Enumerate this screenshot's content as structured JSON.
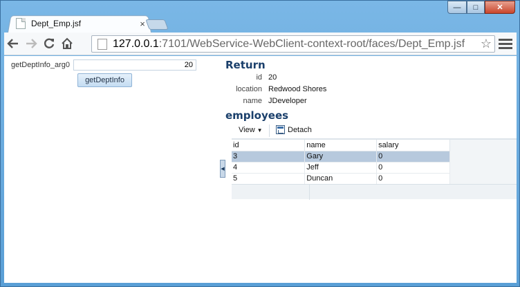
{
  "browser": {
    "tab_title": "Dept_Emp.jsf",
    "tab_close": "×",
    "window_minimize": "—",
    "window_maximize": "□",
    "window_close": "✕",
    "back_icon": "arrow-left-icon",
    "forward_icon": "arrow-right-icon",
    "reload_icon": "reload-icon",
    "home_icon": "home-icon",
    "url_host": "127.0.0.1",
    "url_rest": ":7101/WebService-WebClient-context-root/faces/Dept_Emp.jsf",
    "bookmark_icon": "star-icon",
    "menu_icon": "hamburger-icon"
  },
  "form": {
    "param_label": "getDeptInfo_arg0",
    "param_value": "20",
    "invoke_label": "getDeptInfo"
  },
  "result": {
    "title": "Return",
    "fields": [
      {
        "label": "id",
        "value": "20"
      },
      {
        "label": "location",
        "value": "Redwood Shores"
      },
      {
        "label": "name",
        "value": "JDeveloper"
      }
    ]
  },
  "employees": {
    "title": "employees",
    "view_label": "View",
    "detach_label": "Detach",
    "columns": [
      "id",
      "name",
      "salary"
    ],
    "rows": [
      {
        "id": "3",
        "name": "Gary",
        "salary": "0",
        "selected": true
      },
      {
        "id": "4",
        "name": "Jeff",
        "salary": "0",
        "selected": false
      },
      {
        "id": "5",
        "name": "Duncan",
        "salary": "0",
        "selected": false
      }
    ]
  }
}
